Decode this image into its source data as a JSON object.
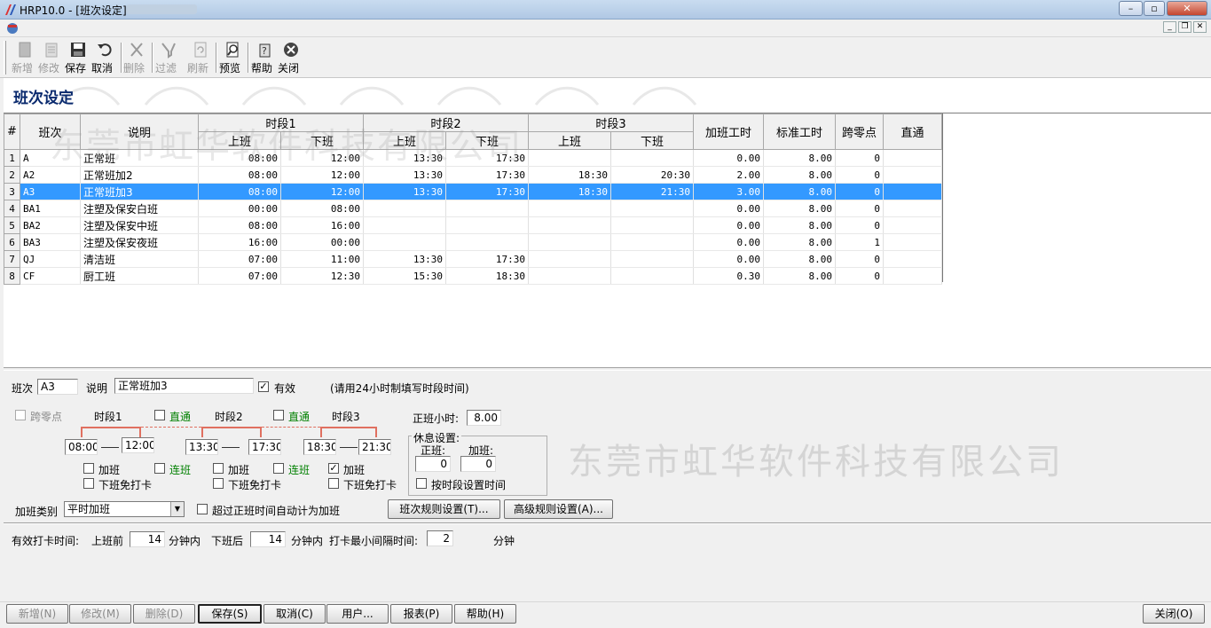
{
  "window": {
    "title": "HRP10.0 - [班次设定]"
  },
  "toolbar": {
    "items": [
      {
        "label": "新增",
        "icon": "new-doc-icon",
        "enabled": false
      },
      {
        "label": "修改",
        "icon": "edit-doc-icon",
        "enabled": false
      },
      {
        "label": "保存",
        "icon": "floppy-disk-icon",
        "enabled": true
      },
      {
        "label": "取消",
        "icon": "undo-arrow-icon",
        "enabled": true
      },
      {
        "label": "删除",
        "icon": "delete-x-icon",
        "enabled": false
      },
      {
        "label": "过滤",
        "icon": "filter-icon",
        "enabled": false
      },
      {
        "label": "刷新",
        "icon": "refresh-icon",
        "enabled": false
      },
      {
        "label": "预览",
        "icon": "preview-icon",
        "enabled": true
      },
      {
        "label": "帮助",
        "icon": "help-icon",
        "enabled": true
      },
      {
        "label": "关闭",
        "icon": "close-circle-icon",
        "enabled": true
      }
    ]
  },
  "page": {
    "title": "班次设定"
  },
  "grid": {
    "watermark": "东莞市虹华软件科技有限公司",
    "headers": {
      "index": "#",
      "code": "班次",
      "desc": "说明",
      "seg1": "时段1",
      "seg2": "时段2",
      "seg3": "时段3",
      "on": "上班",
      "off": "下班",
      "overtime": "加班工时",
      "standard": "标准工时",
      "cross": "跨零点",
      "direct": "直通"
    },
    "rows": [
      {
        "idx": "1",
        "code": "A",
        "desc": "正常班",
        "s1on": "08:00",
        "s1off": "12:00",
        "s2on": "13:30",
        "s2off": "17:30",
        "s3on": "",
        "s3off": "",
        "ot": "0.00",
        "std": "8.00",
        "cross": "0"
      },
      {
        "idx": "2",
        "code": "A2",
        "desc": "正常班加2",
        "s1on": "08:00",
        "s1off": "12:00",
        "s2on": "13:30",
        "s2off": "17:30",
        "s3on": "18:30",
        "s3off": "20:30",
        "ot": "2.00",
        "std": "8.00",
        "cross": "0"
      },
      {
        "idx": "3",
        "code": "A3",
        "desc": "正常班加3",
        "s1on": "08:00",
        "s1off": "12:00",
        "s2on": "13:30",
        "s2off": "17:30",
        "s3on": "18:30",
        "s3off": "21:30",
        "ot": "3.00",
        "std": "8.00",
        "cross": "0"
      },
      {
        "idx": "4",
        "code": "BA1",
        "desc": "注塑及保安白班",
        "s1on": "00:00",
        "s1off": "08:00",
        "s2on": "",
        "s2off": "",
        "s3on": "",
        "s3off": "",
        "ot": "0.00",
        "std": "8.00",
        "cross": "0"
      },
      {
        "idx": "5",
        "code": "BA2",
        "desc": "注塑及保安中班",
        "s1on": "08:00",
        "s1off": "16:00",
        "s2on": "",
        "s2off": "",
        "s3on": "",
        "s3off": "",
        "ot": "0.00",
        "std": "8.00",
        "cross": "0"
      },
      {
        "idx": "6",
        "code": "BA3",
        "desc": "注塑及保安夜班",
        "s1on": "16:00",
        "s1off": "00:00",
        "s2on": "",
        "s2off": "",
        "s3on": "",
        "s3off": "",
        "ot": "0.00",
        "std": "8.00",
        "cross": "1"
      },
      {
        "idx": "7",
        "code": "QJ",
        "desc": "清洁班",
        "s1on": "07:00",
        "s1off": "11:00",
        "s2on": "13:30",
        "s2off": "17:30",
        "s3on": "",
        "s3off": "",
        "ot": "0.00",
        "std": "8.00",
        "cross": "0"
      },
      {
        "idx": "8",
        "code": "CF",
        "desc": "厨工班",
        "s1on": "07:00",
        "s1off": "12:30",
        "s2on": "15:30",
        "s2off": "18:30",
        "s3on": "",
        "s3off": "",
        "ot": "0.30",
        "std": "8.00",
        "cross": "0"
      }
    ],
    "selected_row": 3
  },
  "form": {
    "shift_label": "班次",
    "shift_value": "A3",
    "desc_label": "说明",
    "desc_value": "正常班加3",
    "valid_label": "有效",
    "valid_checked": true,
    "hint": "(请用24小时制填写时段时间)",
    "cross_label": "跨零点",
    "seg1_label": "时段1",
    "seg2_label": "时段2",
    "seg3_label": "时段3",
    "direct_label": "直通",
    "seg1_on": "08:00",
    "seg1_off": "12:00",
    "seg2_on": "13:30",
    "seg2_off": "17:30",
    "seg3_on": "18:30",
    "seg3_off": "21:30",
    "overtime_label": "加班",
    "free_punch_label": "下班免打卡",
    "continuous_label": "连班",
    "normal_hours_label": "正班小时:",
    "normal_hours_value": "8.00",
    "rest_group_label": "休息设置:",
    "rest_normal_label": "正班:",
    "rest_normal_value": "0",
    "rest_ot_label": "加班:",
    "rest_ot_value": "0",
    "by_segment_label": "按时段设置时间",
    "ot_type_label": "加班类别",
    "ot_type_value": "平时加班",
    "auto_ot_label": "超过正班时间自动计为加班",
    "shift_rule_btn": "班次规则设置(T)...",
    "advanced_rule_btn": "高级规则设置(A)...",
    "watermark": "东莞市虹华软件科技有限公司",
    "punch_label": "有效打卡时间:",
    "before_on_label": "上班前",
    "before_on_value": "14",
    "minutes_in": "分钟内",
    "after_off_label": "下班后",
    "after_off_value": "14",
    "min_interval_label": "打卡最小间隔时间:",
    "min_interval_value": "2",
    "minutes": "分钟"
  },
  "bottom": {
    "buttons": [
      {
        "label": "新增(N)",
        "enabled": false
      },
      {
        "label": "修改(M)",
        "enabled": false
      },
      {
        "label": "删除(D)",
        "enabled": false
      },
      {
        "label": "保存(S)",
        "enabled": true
      },
      {
        "label": "取消(C)",
        "enabled": true
      },
      {
        "label": "用户...",
        "enabled": true
      },
      {
        "label": "报表(P)",
        "enabled": true
      },
      {
        "label": "帮助(H)",
        "enabled": true
      }
    ],
    "close_label": "关闭(O)"
  }
}
